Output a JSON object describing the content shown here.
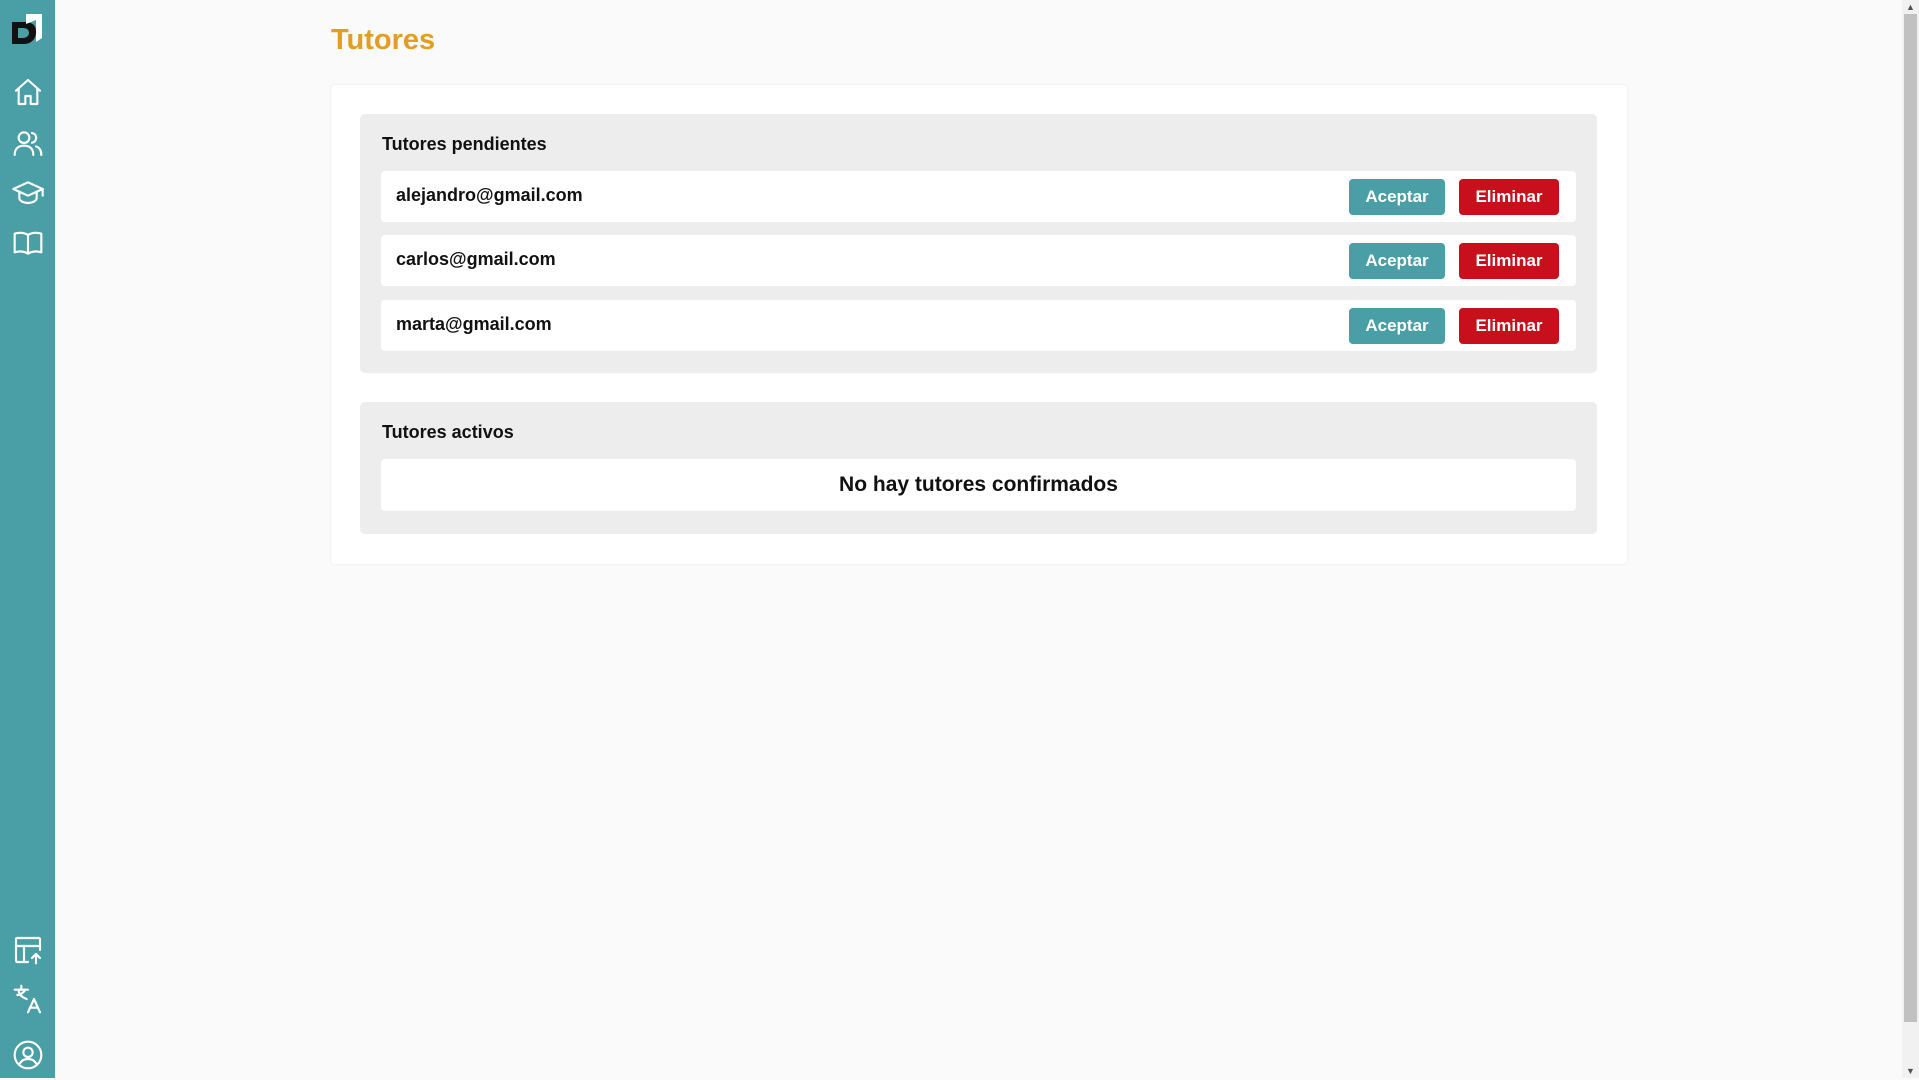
{
  "page": {
    "title": "Tutores"
  },
  "sidebar": {
    "top_icons": [
      "home-icon",
      "users-icon",
      "graduation-cap-icon",
      "book-icon"
    ],
    "bottom_icons": [
      "table-upload-icon",
      "translate-icon",
      "user-circle-icon"
    ]
  },
  "pending": {
    "title": "Tutores pendientes",
    "accept_label": "Aceptar",
    "delete_label": "Eliminar",
    "rows": [
      {
        "email": "alejandro@gmail.com"
      },
      {
        "email": "carlos@gmail.com"
      },
      {
        "email": "marta@gmail.com"
      }
    ]
  },
  "active": {
    "title": "Tutores activos",
    "empty_text": "No hay tutores confirmados"
  },
  "colors": {
    "sidebar": "#4a9ea6",
    "title": "#e39e21",
    "accept": "#4a9ea6",
    "delete": "#c8101c"
  }
}
